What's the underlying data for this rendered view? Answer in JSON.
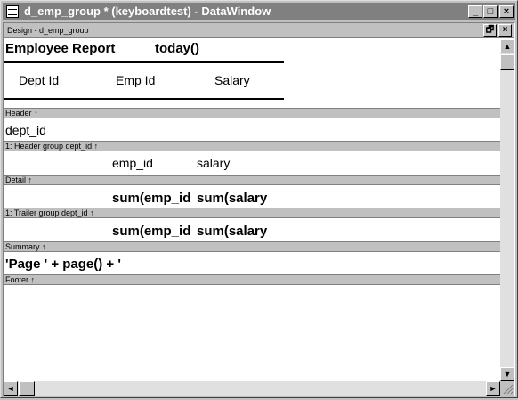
{
  "window": {
    "title": "d_emp_group * (keyboardtest) - DataWindow",
    "minimize": "_",
    "maximize": "□",
    "close": "×"
  },
  "design": {
    "title": "Design - d_emp_group",
    "restore": "🗗",
    "close": "×"
  },
  "report": {
    "title": "Employee Report",
    "date_expr": "today()",
    "col_dept": "Dept Id",
    "col_emp": "Emp Id",
    "col_salary": "Salary"
  },
  "bands": {
    "header": "Header ↑",
    "header_group": "1: Header group dept_id ↑",
    "detail": "Detail ↑",
    "trailer_group": "1: Trailer group dept_id ↑",
    "summary": "Summary ↑",
    "footer": "Footer ↑"
  },
  "fields": {
    "dept_id": "dept_id",
    "emp_id": "emp_id",
    "salary": "salary",
    "detail_sum_emp": "sum(emp_id",
    "detail_sum_salary": "sum(salary",
    "trailer_sum_emp": "sum(emp_id",
    "trailer_sum_salary": "sum(salary",
    "page_expr": "'Page ' + page() + '"
  },
  "scroll": {
    "up": "▲",
    "down": "▼",
    "left": "◄",
    "right": "►"
  }
}
